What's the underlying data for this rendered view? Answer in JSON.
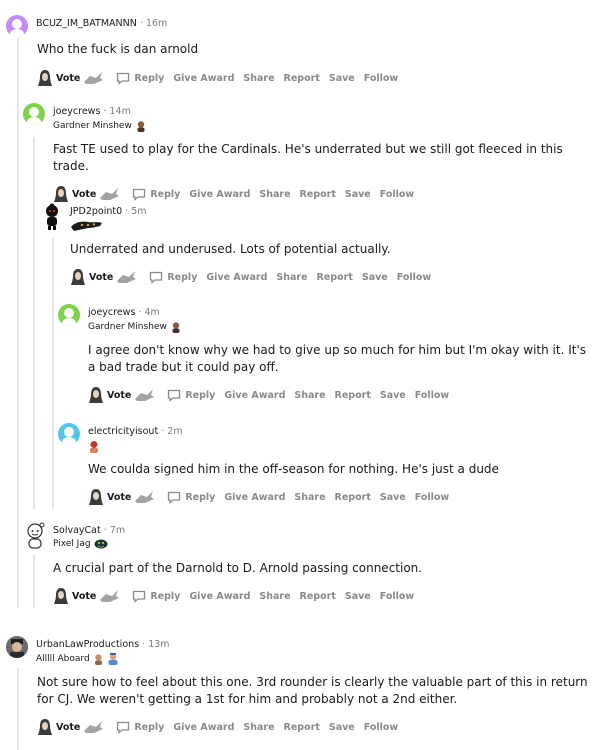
{
  "actions": {
    "vote": "Vote",
    "reply": "Reply",
    "give_award": "Give Award",
    "share": "Share",
    "report": "Report",
    "save": "Save",
    "follow": "Follow"
  },
  "comments": [
    {
      "username": "BCUZ_IM_BATMANNN",
      "time": "16m",
      "flair": "",
      "body": "Who the fuck is dan arnold",
      "avatar_color": "#c58af9"
    },
    {
      "username": "joeycrews",
      "time": "14m",
      "flair": "Gardner Minshew",
      "body": "Fast TE used to play for the Cardinals. He's underrated but we still got fleeced in this trade.",
      "avatar_color": "#7ed348"
    },
    {
      "username": "JPD2point0",
      "time": "5m",
      "flair": "",
      "body": "Underrated and underused. Lots of potential actually.",
      "avatar_color": "#111111"
    },
    {
      "username": "joeycrews",
      "time": "4m",
      "flair": "Gardner Minshew",
      "body": "I agree don't know why we had to give up so much for him but I'm okay with it. It's a bad trade but it could pay off.",
      "avatar_color": "#7ed348"
    },
    {
      "username": "electricityisout",
      "time": "2m",
      "flair": "",
      "body": "We coulda signed him in the off-season for nothing. He's just a dude",
      "avatar_color": "#54c6e8"
    },
    {
      "username": "SolvayCat",
      "time": "7m",
      "flair": "Pixel Jag",
      "body": "A crucial part of the Darnold to D. Arnold passing connection.",
      "avatar_color": "#ffffff"
    },
    {
      "username": "UrbanLawProductions",
      "time": "13m",
      "flair": "Alllll Aboard",
      "body": "Not sure how to feel about this one. 3rd rounder is clearly the valuable part of this in return for CJ. We weren't getting a 1st for him and probably not a 2nd either.",
      "avatar_color": "#555555"
    }
  ],
  "separator": "·"
}
